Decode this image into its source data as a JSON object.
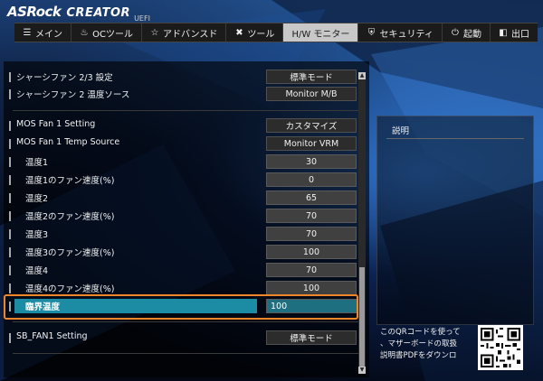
{
  "header": {
    "brand": "ASRock",
    "series": "CREATOR",
    "uefi": "UEFI"
  },
  "tabs": [
    {
      "label": "メイン",
      "icon": "list-icon",
      "active": false
    },
    {
      "label": "OCツール",
      "icon": "flame-icon",
      "active": false
    },
    {
      "label": "アドバンスド",
      "icon": "star-icon",
      "active": false
    },
    {
      "label": "ツール",
      "icon": "tools-icon",
      "active": false
    },
    {
      "label": "H/W モニター",
      "icon": "",
      "active": true
    },
    {
      "label": "セキュリティ",
      "icon": "shield-icon",
      "active": false
    },
    {
      "label": "起動",
      "icon": "power-icon",
      "active": false
    },
    {
      "label": "出口",
      "icon": "exit-icon",
      "active": false
    }
  ],
  "settings": [
    {
      "label": "シャーシファン 2/3 設定",
      "value": "標準モード"
    },
    {
      "label": "シャーシファン 2 温度ソース",
      "value": "Monitor M/B"
    },
    {
      "label": "MOS Fan 1 Setting",
      "value": "カスタマイズ"
    },
    {
      "label": "MOS Fan 1 Temp Source",
      "value": "Monitor VRM"
    },
    {
      "label": "温度1",
      "value": "30"
    },
    {
      "label": "温度1のファン速度(%)",
      "value": "0"
    },
    {
      "label": "温度2",
      "value": "65"
    },
    {
      "label": "温度2のファン速度(%)",
      "value": "70"
    },
    {
      "label": "温度3",
      "value": "70"
    },
    {
      "label": "温度3のファン速度(%)",
      "value": "100"
    },
    {
      "label": "温度4",
      "value": "70"
    },
    {
      "label": "温度4のファン速度(%)",
      "value": "100"
    },
    {
      "label": "臨界温度",
      "value": "100"
    },
    {
      "label": "SB_FAN1 Setting",
      "value": "標準モード"
    }
  ],
  "description": {
    "title": "説明",
    "qr_lines": [
      "このQRコードを使って",
      "、マザーボードの取扱",
      "説明書PDFをダウンロ"
    ]
  },
  "colors": {
    "selection": "#1b8ca3",
    "highlight_outline": "#f0862a",
    "active_tab": "#c8c8c8"
  }
}
